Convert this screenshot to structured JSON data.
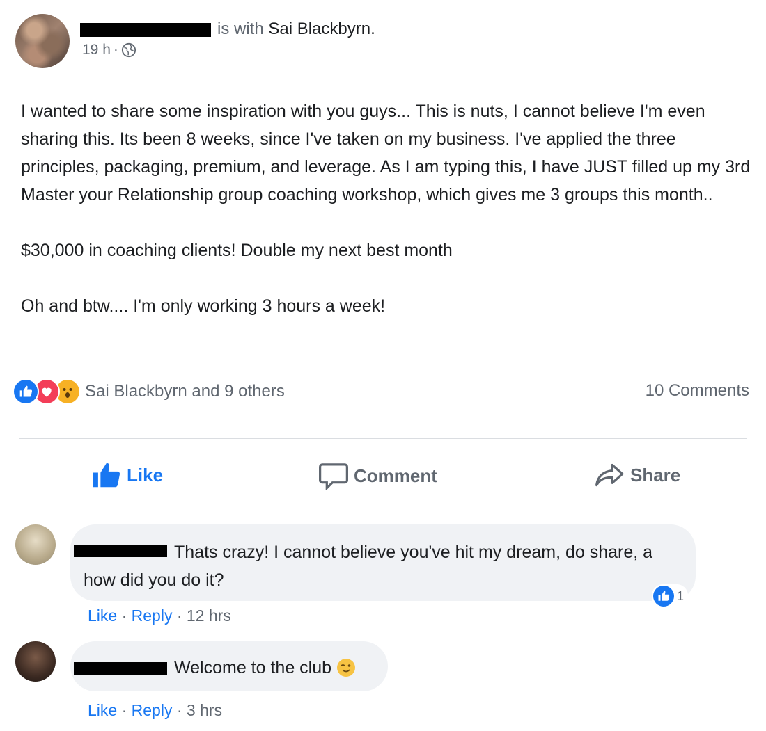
{
  "post": {
    "author_relation": "is with",
    "tagged_name": "Sai Blackbyrn.",
    "time": "19 h",
    "time_separator": "·",
    "privacy_icon": "globe-icon",
    "body": "I wanted to share some inspiration with you guys... This is nuts, I cannot believe I'm even sharing this. Its been 8 weeks, since I've taken on my business. I've applied the three principles, packaging, premium, and leverage. As I am typing this, I have JUST filled up my 3rd Master your Relationship group coaching workshop, which gives me 3 groups this month..\n\n$30,000 in coaching clients! Double my next best month\n\nOh and btw.... I'm only working 3 hours a week!"
  },
  "reactions": {
    "icons": [
      "like-reaction-icon",
      "love-reaction-icon",
      "wow-reaction-icon"
    ],
    "label": "Sai Blackbyrn and 9 others",
    "comments_count": "10 Comments"
  },
  "actions": {
    "like": "Like",
    "comment": "Comment",
    "share": "Share"
  },
  "comments": [
    {
      "text": "Thats crazy! I cannot believe you've hit my dream, do share, a how did you do it?",
      "like_count": "1",
      "like": "Like",
      "reply": "Reply",
      "time": "12 hrs",
      "sep": "·"
    },
    {
      "text": "Welcome to the club",
      "emoji": "winking-face-emoji",
      "like": "Like",
      "reply": "Reply",
      "time": "3 hrs",
      "sep": "·"
    }
  ],
  "colors": {
    "accent": "#1877f2",
    "muted": "#606770",
    "bubble": "#f0f2f5"
  }
}
